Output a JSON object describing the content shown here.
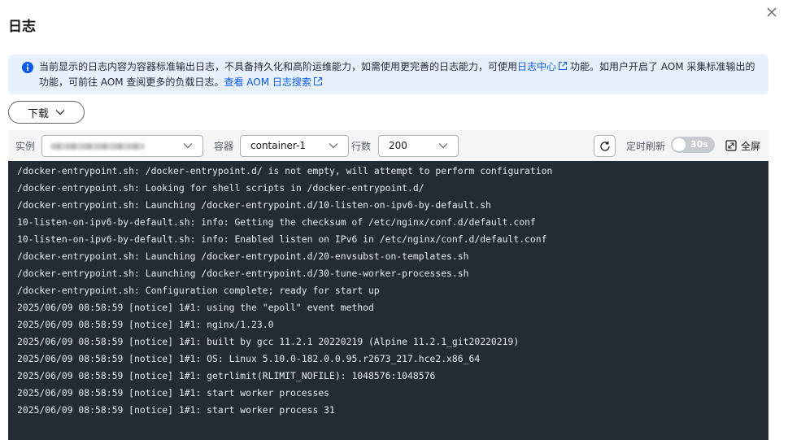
{
  "dialog": {
    "title": "日志"
  },
  "notice": {
    "text_before_link": "当前显示的日志内容为容器标准输出日志，不具备持久化和高阶运维能力，如需使用更完善的日志能力，可使用",
    "link1": "日志中心",
    "text_after_link": "功能。如用户开启了 AOM 采集标准输出的功能，可前往 AOM 查阅更多的负载日志。",
    "link2": "查看 AOM 日志搜索"
  },
  "toolbar": {
    "download_label": "下载",
    "instance_label": "实例",
    "container_label": "容器",
    "container_value": "container-1",
    "lines_label": "行数",
    "lines_value": "200",
    "auto_refresh_label": "定时刷新",
    "auto_refresh_interval": "30s",
    "auto_refresh_enabled": false,
    "fullscreen_label": "全屏"
  },
  "log_lines": [
    "/docker-entrypoint.sh: /docker-entrypoint.d/ is not empty, will attempt to perform configuration",
    "/docker-entrypoint.sh: Looking for shell scripts in /docker-entrypoint.d/",
    "/docker-entrypoint.sh: Launching /docker-entrypoint.d/10-listen-on-ipv6-by-default.sh",
    "10-listen-on-ipv6-by-default.sh: info: Getting the checksum of /etc/nginx/conf.d/default.conf",
    "10-listen-on-ipv6-by-default.sh: info: Enabled listen on IPv6 in /etc/nginx/conf.d/default.conf",
    "/docker-entrypoint.sh: Launching /docker-entrypoint.d/20-envsubst-on-templates.sh",
    "/docker-entrypoint.sh: Launching /docker-entrypoint.d/30-tune-worker-processes.sh",
    "/docker-entrypoint.sh: Configuration complete; ready for start up",
    "2025/06/09 08:58:59 [notice] 1#1: using the \"epoll\" event method",
    "2025/06/09 08:58:59 [notice] 1#1: nginx/1.23.0",
    "2025/06/09 08:58:59 [notice] 1#1: built by gcc 11.2.1 20220219 (Alpine 11.2.1_git20220219)",
    "2025/06/09 08:58:59 [notice] 1#1: OS: Linux 5.10.0-182.0.0.95.r2673_217.hce2.x86_64",
    "2025/06/09 08:58:59 [notice] 1#1: getrlimit(RLIMIT_NOFILE): 1048576:1048576",
    "2025/06/09 08:58:59 [notice] 1#1: start worker processes",
    "2025/06/09 08:58:59 [notice] 1#1: start worker process 31"
  ],
  "colors": {
    "accent": "#0a59f7",
    "notice_bg": "#e6f1fd",
    "log_bg": "#252b35",
    "log_text": "#e9ebef"
  },
  "icons": [
    "close-icon",
    "info-icon",
    "external-link-icon",
    "chevron-down-icon",
    "refresh-icon",
    "fullscreen-icon"
  ]
}
